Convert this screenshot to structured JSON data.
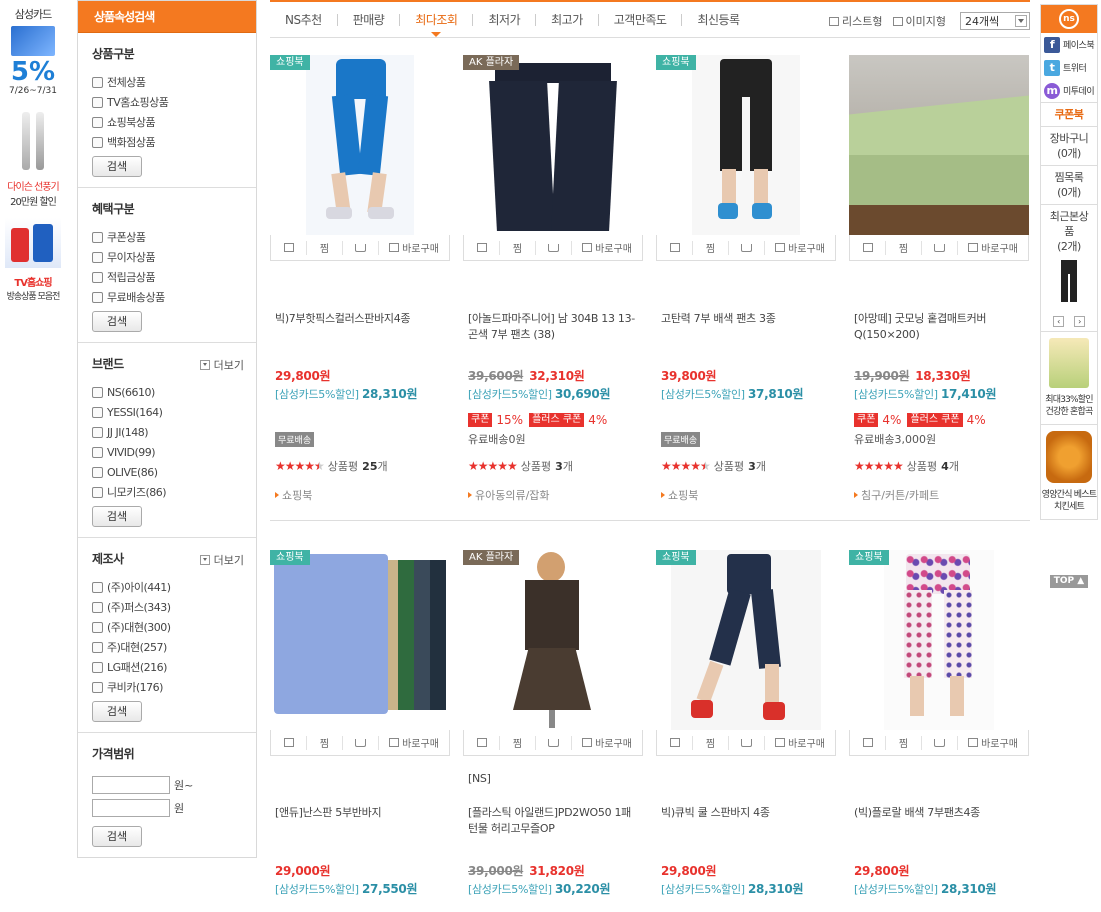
{
  "left_ads": {
    "card_title": "삼성카드",
    "card_pct": "5%",
    "card_date": "7/26~7/31",
    "dyson_title": "다이슨 선풍기",
    "dyson_sub": "20만원 할인",
    "tv_title": "TV홈쇼핑",
    "tv_sub": "방송상품 모음전"
  },
  "sidebar": {
    "header": "상품속성검색",
    "search_label": "검색",
    "more_label": "더보기",
    "sections": [
      {
        "title": "상품구분",
        "items": [
          "전체상품",
          "TV홈쇼핑상품",
          "쇼핑북상품",
          "백화점상품"
        ]
      },
      {
        "title": "혜택구분",
        "items": [
          "쿠폰상품",
          "무이자상품",
          "적립금상품",
          "무료배송상품"
        ]
      },
      {
        "title": "브랜드",
        "items": [
          "NS(6610)",
          "YESSI(164)",
          "JJ JI(148)",
          "VIVID(99)",
          "OLIVE(86)",
          "니모키즈(86)"
        ]
      },
      {
        "title": "제조사",
        "items": [
          "(주)아이(441)",
          "(주)퍼스(343)",
          "(주)대현(300)",
          "주)대현(257)",
          "LG패션(216)",
          "쿠비카(176)"
        ]
      }
    ],
    "price_title": "가격범위",
    "price_from": "원~",
    "price_to": "원"
  },
  "sort": {
    "tabs": [
      "NS추천",
      "판매량",
      "최다조회",
      "최저가",
      "최고가",
      "고객만족도",
      "최신등록"
    ],
    "active": "최다조회",
    "list_view": "리스트형",
    "image_view": "이미지형",
    "per_page": "24개씩"
  },
  "actions": {
    "zzim": "찜",
    "buy": "바로구매"
  },
  "products": [
    {
      "tag": "쇼핑북",
      "tag_color": "#3fb3a5",
      "name": "빅)7부핫픽스컬러스판바지4종",
      "orig": "",
      "price": "29,800원",
      "card": "[삼성카드5%할인]",
      "card_price": "28,310원",
      "coupon": "",
      "plus": "",
      "ship": "",
      "free": "무료배송",
      "stars": "★★★★★",
      "rating": 4.5,
      "review_label": "상품평",
      "reviews": "25",
      "review_unit": "개",
      "cat": "쇼핑북"
    },
    {
      "tag": "AK 플라자",
      "tag_color": "#7a6a58",
      "name": "[아놀드파마주니어] 남 304B 13 13- 곤색 7부 팬츠 (38)",
      "orig": "39,600원",
      "price": "32,310원",
      "card": "[삼성카드5%할인]",
      "card_price": "30,690원",
      "coupon": "15%",
      "plus": "4%",
      "ship": "유료배송0원",
      "free": "",
      "stars": "★★★★★",
      "rating": 5,
      "review_label": "상품평",
      "reviews": "3",
      "review_unit": "개",
      "cat": "유아동의류/잡화"
    },
    {
      "tag": "쇼핑북",
      "tag_color": "#3fb3a5",
      "name": "고탄력 7부 배색 팬츠 3종",
      "orig": "",
      "price": "39,800원",
      "card": "[삼성카드5%할인]",
      "card_price": "37,810원",
      "coupon": "",
      "plus": "",
      "ship": "",
      "free": "무료배송",
      "stars": "★★★★★",
      "rating": 4.5,
      "review_label": "상품평",
      "reviews": "3",
      "review_unit": "개",
      "cat": "쇼핑북"
    },
    {
      "tag": "",
      "tag_color": "",
      "name": "[아망떼] 굿모닝 홑겹매트커버 Q(150×200)",
      "orig": "19,900원",
      "price": "18,330원",
      "card": "[삼성카드5%할인]",
      "card_price": "17,410원",
      "coupon": "4%",
      "plus": "4%",
      "ship": "유료배송3,000원",
      "free": "",
      "stars": "★★★★★",
      "rating": 5,
      "review_label": "상품평",
      "reviews": "4",
      "review_unit": "개",
      "cat": "침구/커튼/카페트"
    },
    {
      "tag": "쇼핑북",
      "tag_color": "#3fb3a5",
      "name": "[앤듀]난스판 5부반바지",
      "orig": "",
      "price": "29,000원",
      "card": "[삼성카드5%할인]",
      "card_price": "27,550원",
      "pre": ""
    },
    {
      "tag": "AK 플라자",
      "tag_color": "#7a6a58",
      "name": "[플라스틱 아일랜드]PD2WO50 1패턴물 허리고무즐OP",
      "orig": "39,000원",
      "price": "31,820원",
      "card": "[삼성카드5%할인]",
      "card_price": "30,220원",
      "pre": "[NS]"
    },
    {
      "tag": "쇼핑북",
      "tag_color": "#3fb3a5",
      "name": "빅)큐빅 쿨 스판바지 4종",
      "orig": "",
      "price": "29,800원",
      "card": "[삼성카드5%할인]",
      "card_price": "28,310원",
      "pre": ""
    },
    {
      "tag": "쇼핑북",
      "tag_color": "#3fb3a5",
      "name": "(빅)플로랄 배색 7부팬츠4종",
      "orig": "",
      "price": "29,800원",
      "card": "[삼성카드5%할인]",
      "card_price": "28,310원",
      "pre": ""
    }
  ],
  "coupon_label": "쿠폰",
  "plus_label": "플러스 쿠폰",
  "rail": {
    "logo": "ns",
    "sns": [
      "페이스북",
      "트위터",
      "미투데이"
    ],
    "coupon_book": "쿠폰북",
    "cart": "장바구니",
    "cart_count": "(0개)",
    "wish": "찜목록",
    "wish_count": "(0개)",
    "recent": "최근본상품",
    "recent_count": "(2개)",
    "ad1": "최대33%할인 건강한 혼합곡",
    "ad2": "영양간식 베스트치킨세트",
    "top": "TOP"
  }
}
